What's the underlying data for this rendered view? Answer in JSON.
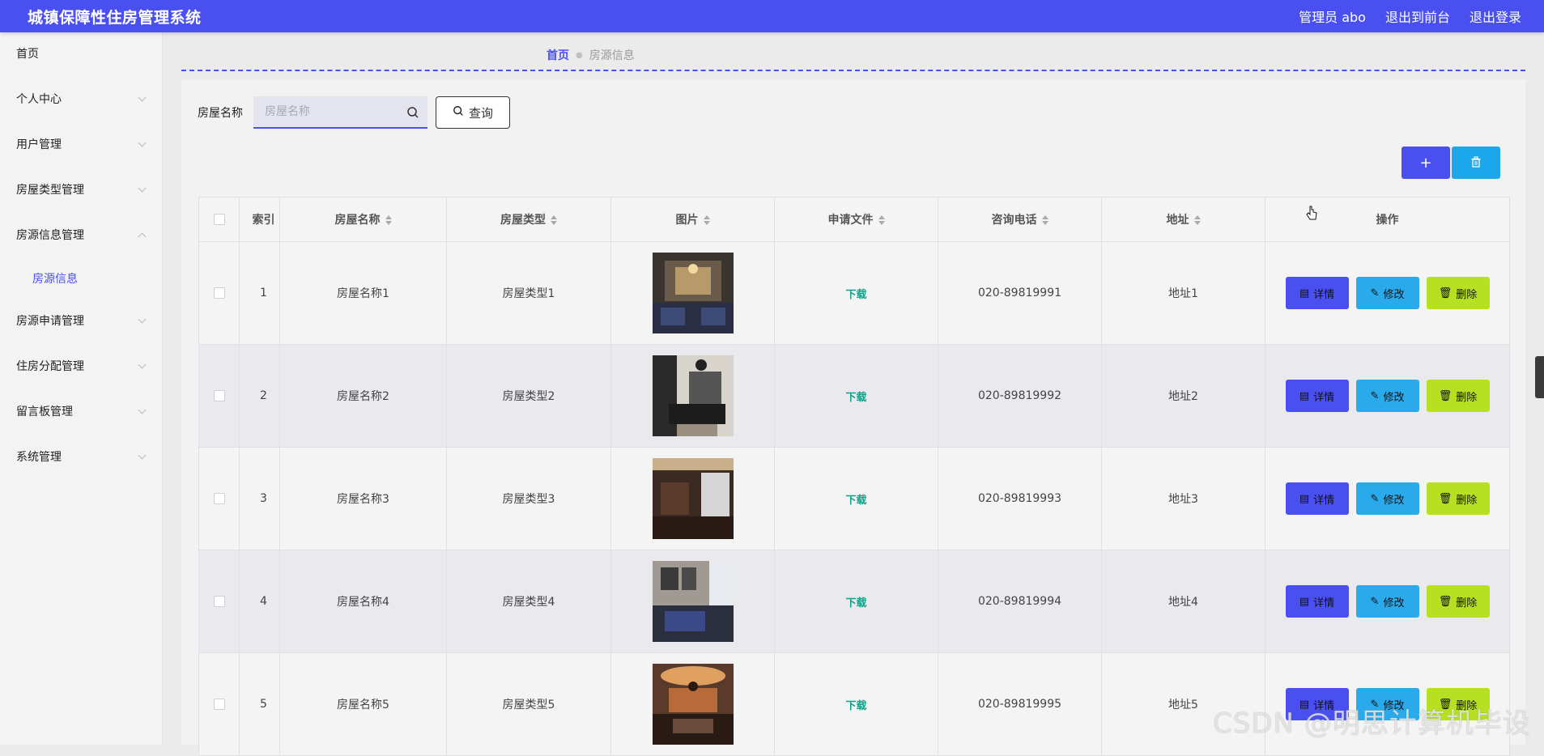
{
  "header": {
    "title": "城镇保障性住房管理系统",
    "user": "管理员 abo",
    "to_front": "退出到前台",
    "logout": "退出登录"
  },
  "sidebar": {
    "items": [
      {
        "label": "首页",
        "expanded": null
      },
      {
        "label": "个人中心",
        "expanded": false
      },
      {
        "label": "用户管理",
        "expanded": false
      },
      {
        "label": "房屋类型管理",
        "expanded": false
      },
      {
        "label": "房源信息管理",
        "expanded": true
      },
      {
        "label": "房源申请管理",
        "expanded": false
      },
      {
        "label": "住房分配管理",
        "expanded": false
      },
      {
        "label": "留言板管理",
        "expanded": false
      },
      {
        "label": "系统管理",
        "expanded": false
      }
    ],
    "submenu": {
      "label": "房源信息",
      "parent": "房源信息管理",
      "active": true
    }
  },
  "breadcrumb": {
    "home": "首页",
    "current": "房源信息"
  },
  "search": {
    "label": "房屋名称",
    "placeholder": "房屋名称",
    "value": "",
    "button": "查询"
  },
  "table": {
    "headers": {
      "index": "索引",
      "name": "房屋名称",
      "type": "房屋类型",
      "image": "图片",
      "file": "申请文件",
      "phone": "咨询电话",
      "address": "地址",
      "ops": "操作"
    },
    "ops_labels": {
      "detail": "详情",
      "edit": "修改",
      "remove": "删除"
    },
    "rows": [
      {
        "index": "1",
        "name": "房屋名称1",
        "type": "房屋类型1",
        "file": "下载",
        "phone": "020-89819991",
        "address": "地址1"
      },
      {
        "index": "2",
        "name": "房屋名称2",
        "type": "房屋类型2",
        "file": "下载",
        "phone": "020-89819992",
        "address": "地址2"
      },
      {
        "index": "3",
        "name": "房屋名称3",
        "type": "房屋类型3",
        "file": "下载",
        "phone": "020-89819993",
        "address": "地址3"
      },
      {
        "index": "4",
        "name": "房屋名称4",
        "type": "房屋类型4",
        "file": "下载",
        "phone": "020-89819994",
        "address": "地址4"
      },
      {
        "index": "5",
        "name": "房屋名称5",
        "type": "房屋类型5",
        "file": "下载",
        "phone": "020-89819995",
        "address": "地址5"
      }
    ]
  },
  "watermark": "CSDN @明思计算机毕设",
  "colors": {
    "primary": "#4a50f0",
    "edit": "#2baaeb",
    "remove": "#b7e022",
    "download": "#11a28a"
  }
}
